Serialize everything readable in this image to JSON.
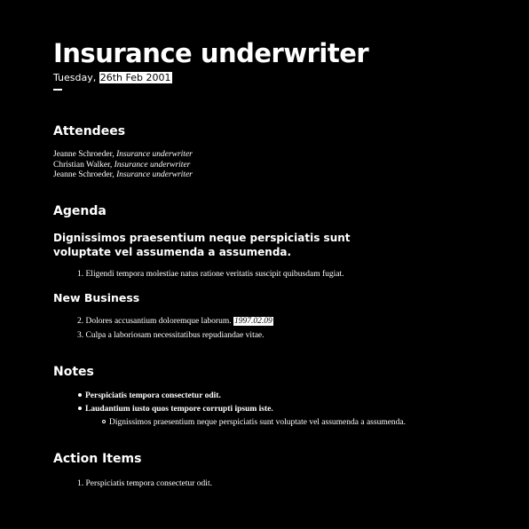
{
  "header": {
    "title": "Insurance underwriter",
    "date_weekday": "Tuesday,",
    "date_value": "26th Feb 2001"
  },
  "attendees": {
    "heading": "Attendees",
    "list": [
      {
        "name": "Jeanne Schroeder,",
        "role": "Insurance underwriter"
      },
      {
        "name": "Christian Walker,",
        "role": "Insurance underwriter"
      },
      {
        "name": "Jeanne Schroeder,",
        "role": "Insurance underwriter"
      }
    ]
  },
  "agenda": {
    "heading": "Agenda",
    "subheading": "Dignissimos praesentium neque perspiciatis sunt voluptate vel assumenda a assumenda.",
    "items": [
      {
        "number": "1.",
        "text": "Eligendi tempora molestiae natus ratione veritatis suscipit quibusdam fugiat."
      }
    ],
    "new_business_heading": "New Business",
    "new_business_items": [
      {
        "number": "2.",
        "text": "Dolores accusantium doloremque laborum.",
        "highlight": "1997.02.09"
      },
      {
        "number": "3.",
        "text": "Culpa a laboriosam necessitatibus repudiandae vitae."
      }
    ]
  },
  "notes": {
    "heading": "Notes",
    "items": [
      "Perspiciatis tempora consectetur odit.",
      "Laudantium iusto quos tempore corrupti ipsum iste."
    ],
    "subitems": [
      "Dignissimos praesentium neque perspiciatis sunt voluptate vel assumenda a assumenda."
    ]
  },
  "action_items": {
    "heading": "Action Items",
    "items": [
      {
        "number": "1.",
        "text": "Perspiciatis tempora consectetur odit."
      }
    ]
  }
}
